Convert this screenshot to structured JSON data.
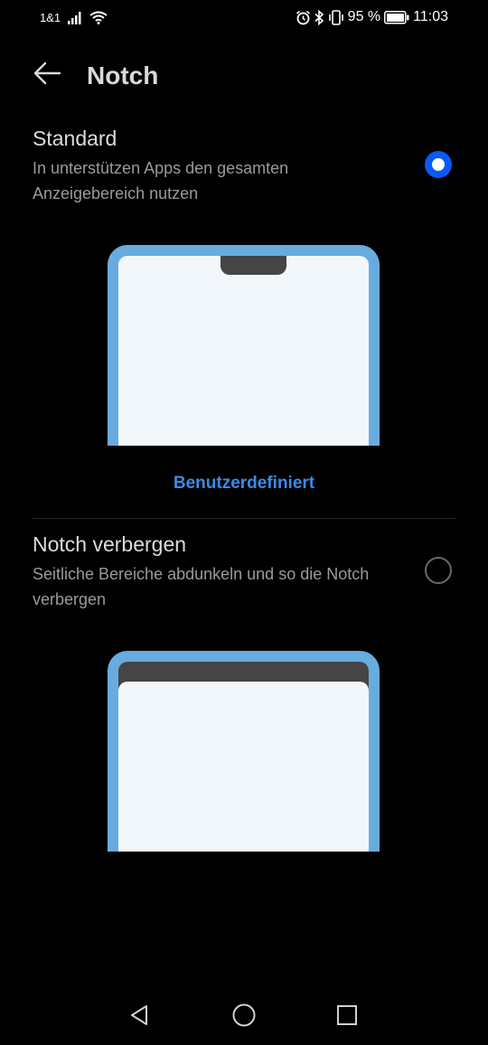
{
  "status_bar": {
    "carrier": "1&1",
    "battery_percent": "95 %",
    "time": "11:03",
    "icons": [
      "signal-icon",
      "wifi-icon",
      "alarm-icon",
      "bluetooth-icon",
      "vibrate-icon",
      "battery-icon"
    ]
  },
  "app_bar": {
    "title": "Notch",
    "back_icon": "arrow-left-icon"
  },
  "options": [
    {
      "title": "Standard",
      "description": "In unterstützen Apps den gesamten Anzeigebereich nutzen",
      "selected": true
    },
    {
      "title": "Notch verbergen",
      "description": "Seitliche Bereiche abdunkeln und so die Notch verbergen",
      "selected": false
    }
  ],
  "custom_link": "Benutzerdefiniert",
  "nav_bar": {
    "icons": [
      "back-triangle-icon",
      "home-circle-icon",
      "recents-square-icon"
    ]
  },
  "colors": {
    "accent": "#0a59f7",
    "link": "#3b8be6",
    "phone_frame": "#68acdf",
    "phone_screen": "#f2f7fb",
    "notch": "#454545"
  }
}
